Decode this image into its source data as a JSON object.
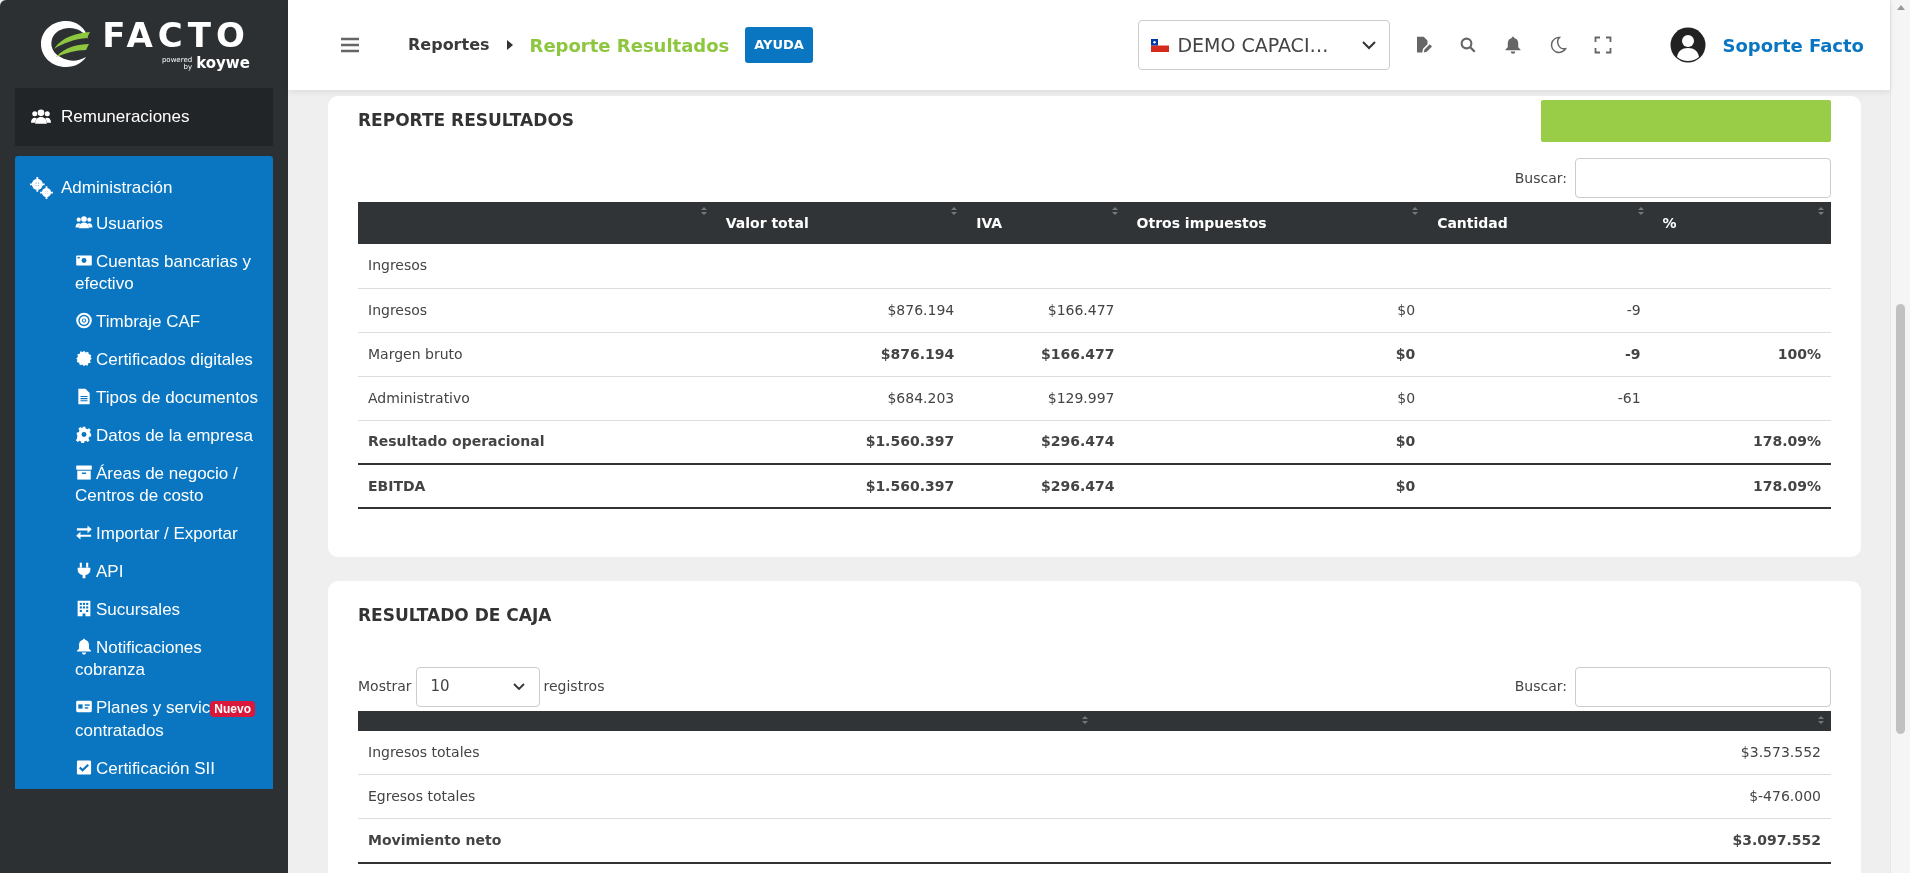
{
  "logo": {
    "name": "FACTO",
    "powered": "powered",
    "by": "by",
    "brand": "koywe"
  },
  "sidebar": {
    "items": [
      {
        "label": "Remuneraciones",
        "expanded": false
      },
      {
        "label": "Administración",
        "expanded": true,
        "children": [
          {
            "label": "Usuarios"
          },
          {
            "label": "Cuentas bancarias y efectivo"
          },
          {
            "label": "Timbraje CAF"
          },
          {
            "label": "Certificados digitales"
          },
          {
            "label": "Tipos de documentos"
          },
          {
            "label": "Datos de la empresa"
          },
          {
            "label": "Áreas de negocio / Centros de costo"
          },
          {
            "label": "Importar / Exportar"
          },
          {
            "label": "API"
          },
          {
            "label": "Sucursales"
          },
          {
            "label": "Notificaciones cobranza"
          },
          {
            "label": "Planes y servic",
            "badge": "Nuevo",
            "label_continued": "contratados"
          },
          {
            "label": "Certificación SII"
          }
        ]
      }
    ]
  },
  "header": {
    "breadcrumbs": [
      {
        "label": "Reportes",
        "current": false
      },
      {
        "label": "Reporte Resultados",
        "current": true
      }
    ],
    "help_button": "AYUDA",
    "company": "DEMO CAPACI…",
    "user": "Soporte Facto"
  },
  "report": {
    "title": "REPORTE RESULTADOS",
    "search_label": "Buscar:",
    "columns": [
      {
        "sortable": true
      },
      {
        "label": "Valor total",
        "sortable": true
      },
      {
        "label": "IVA",
        "sortable": true
      },
      {
        "label": "Otros impuestos",
        "sortable": true
      },
      {
        "label": "Cantidad",
        "sortable": true
      },
      {
        "label": "%",
        "sortable": true
      }
    ],
    "rows": [
      {
        "cells": [
          "Ingresos",
          null,
          null,
          null,
          null,
          null
        ],
        "label_bold": false,
        "total": false
      },
      {
        "cells": [
          "Ingresos",
          "$876.194",
          "$166.477",
          "$0",
          "-9",
          null
        ],
        "label_bold": false,
        "values_bold": false,
        "total": false
      },
      {
        "cells": [
          "Margen bruto",
          "$876.194",
          "$166.477",
          "$0",
          "-9",
          "100%"
        ],
        "label_bold": false,
        "values_bold": true,
        "total": false
      },
      {
        "cells": [
          "Administrativo",
          "$684.203",
          "$129.997",
          "$0",
          "-61",
          null
        ],
        "label_bold": false,
        "values_bold": false,
        "total": false
      },
      {
        "cells": [
          "Resultado operacional",
          "$1.560.397",
          "$296.474",
          "$0",
          null,
          "178.09%"
        ],
        "label_bold": true,
        "values_bold": true,
        "total": true
      },
      {
        "cells": [
          "EBITDA",
          "$1.560.397",
          "$296.474",
          "$0",
          null,
          "178.09%"
        ],
        "label_bold": true,
        "values_bold": true,
        "total": true
      }
    ]
  },
  "cash": {
    "title": "RESULTADO DE CAJA",
    "show_label": "Mostrar",
    "page_size": "10",
    "records_label": "registros",
    "search_label": "Buscar:",
    "columns": [
      {
        "sortable": true
      },
      {
        "sortable": true
      }
    ],
    "rows": [
      {
        "cells": [
          "Ingresos totales",
          "$3.573.552"
        ],
        "label_bold": false,
        "values_bold": false,
        "total": false
      },
      {
        "cells": [
          "Egresos totales",
          "$-476.000"
        ],
        "label_bold": false,
        "values_bold": false,
        "total": false
      },
      {
        "cells": [
          "Movimiento neto",
          "$3.097.552"
        ],
        "label_bold": true,
        "values_bold": true,
        "total": true
      }
    ]
  }
}
